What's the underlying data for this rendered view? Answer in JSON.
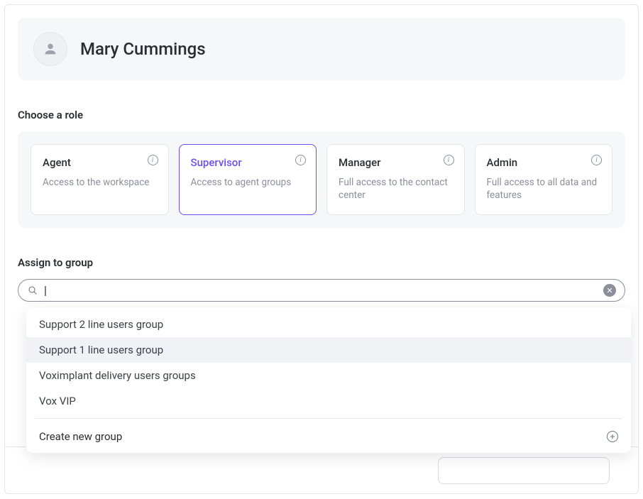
{
  "header": {
    "person_name": "Mary Cummings"
  },
  "sections": {
    "role_title": "Choose a role",
    "group_title": "Assign to group"
  },
  "roles": [
    {
      "title": "Agent",
      "desc": "Access to the workspace",
      "selected": false
    },
    {
      "title": "Supervisor",
      "desc": "Access to agent groups",
      "selected": true
    },
    {
      "title": "Manager",
      "desc": "Full access to the contact center",
      "selected": false
    },
    {
      "title": "Admin",
      "desc": "Full access to all data and features",
      "selected": false
    }
  ],
  "search": {
    "value": "|",
    "placeholder": ""
  },
  "dropdown": {
    "items": [
      {
        "label": "Support 2 line users group",
        "hover": false
      },
      {
        "label": "Support 1 line users group",
        "hover": true
      },
      {
        "label": "Voximplant delivery users groups",
        "hover": false
      },
      {
        "label": "Vox VIP",
        "hover": false
      }
    ],
    "create_label": "Create new group"
  }
}
